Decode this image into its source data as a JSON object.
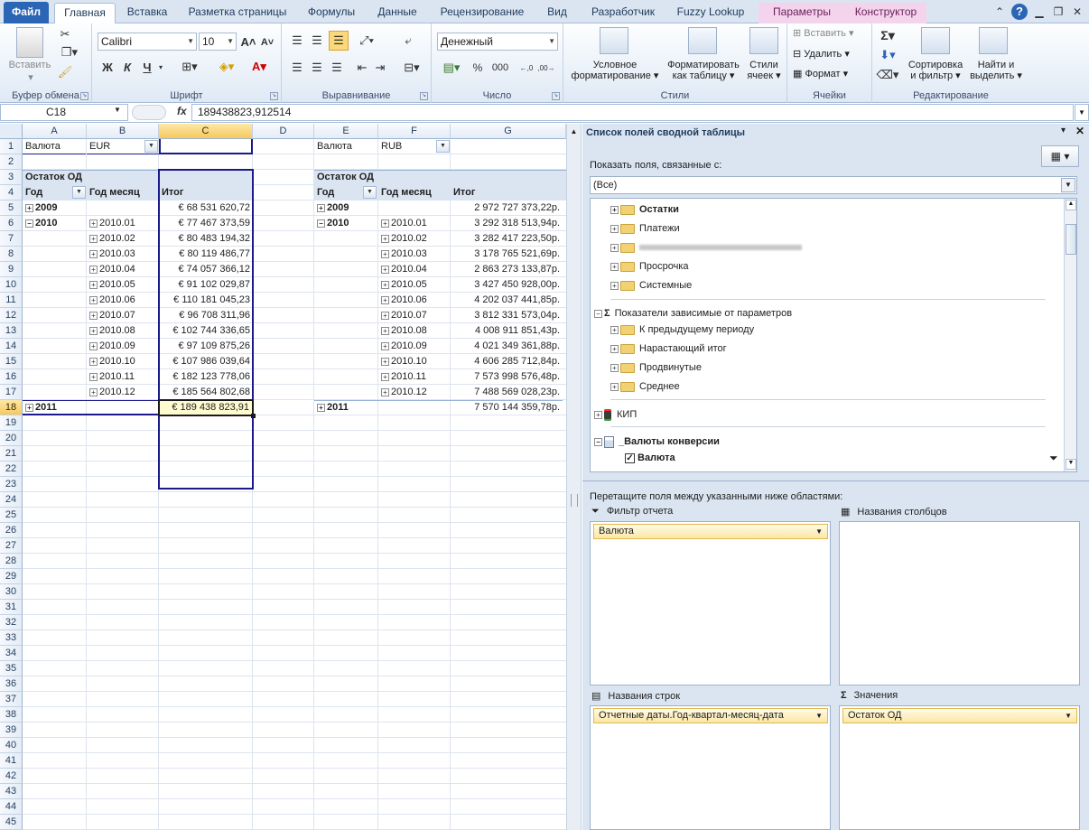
{
  "tabs": {
    "file": "Файл",
    "items": [
      "Главная",
      "Вставка",
      "Разметка страницы",
      "Формулы",
      "Данные",
      "Рецензирование",
      "Вид",
      "Разработчик",
      "Fuzzy Lookup"
    ],
    "context": [
      "Параметры",
      "Конструктор"
    ]
  },
  "ribbon": {
    "clipboard": {
      "paste": "Вставить",
      "label": "Буфер обмена"
    },
    "font": {
      "name": "Calibri",
      "size": "10",
      "label": "Шрифт",
      "bold": "Ж",
      "italic": "К",
      "underline": "Ч"
    },
    "alignment": {
      "label": "Выравнивание"
    },
    "number": {
      "format": "Денежный",
      "percent": "%",
      "thousands": "000",
      "label": "Число"
    },
    "styles": {
      "conditional": "Условное",
      "conditional2": "форматирование",
      "format_table": "Форматировать",
      "format_table2": "как таблицу",
      "cell_styles": "Стили",
      "cell_styles2": "ячеек",
      "label": "Стили"
    },
    "cells": {
      "insert": "Вставить",
      "delete": "Удалить",
      "format": "Формат",
      "label": "Ячейки"
    },
    "editing": {
      "sigma": "Σ",
      "sort": "Сортировка",
      "sort2": "и фильтр",
      "find": "Найти и",
      "find2": "выделить",
      "label": "Редактирование"
    }
  },
  "formula_bar": {
    "name_box": "C18",
    "fx": "fx",
    "value": "189438823,912514"
  },
  "sheet": {
    "columns": [
      "A",
      "B",
      "C",
      "D",
      "E",
      "F",
      "G"
    ],
    "rows": [
      "1",
      "2",
      "3",
      "4",
      "5",
      "6",
      "7",
      "8",
      "9",
      "10",
      "11",
      "12",
      "13",
      "14",
      "15",
      "16",
      "17",
      "18",
      "19",
      "20",
      "21",
      "22",
      "23",
      "24",
      "25",
      "26",
      "27",
      "28",
      "29",
      "30",
      "31",
      "32",
      "33",
      "34",
      "35",
      "36",
      "37",
      "38",
      "39",
      "40",
      "41",
      "42",
      "43",
      "44",
      "45"
    ],
    "left_pivot": {
      "filter_label": "Валюта",
      "filter_value": "EUR",
      "measure": "Остаток ОД",
      "col_year": "Год",
      "col_month": "Год месяц",
      "col_total": "Итог",
      "rows": [
        {
          "year": "2009",
          "month": "",
          "value": "€ 68 531 620,72"
        },
        {
          "year": "2010",
          "month": "2010.01",
          "value": "€ 77 467 373,59"
        },
        {
          "year": "",
          "month": "2010.02",
          "value": "€ 80 483 194,32"
        },
        {
          "year": "",
          "month": "2010.03",
          "value": "€ 80 119 486,77"
        },
        {
          "year": "",
          "month": "2010.04",
          "value": "€ 74 057 366,12"
        },
        {
          "year": "",
          "month": "2010.05",
          "value": "€ 91 102 029,87"
        },
        {
          "year": "",
          "month": "2010.06",
          "value": "€ 110 181 045,23"
        },
        {
          "year": "",
          "month": "2010.07",
          "value": "€ 96 708 311,96"
        },
        {
          "year": "",
          "month": "2010.08",
          "value": "€ 102 744 336,65"
        },
        {
          "year": "",
          "month": "2010.09",
          "value": "€ 97 109 875,26"
        },
        {
          "year": "",
          "month": "2010.10",
          "value": "€ 107 986 039,64"
        },
        {
          "year": "",
          "month": "2010.11",
          "value": "€ 182 123 778,06"
        },
        {
          "year": "",
          "month": "2010.12",
          "value": "€ 185 564 802,68"
        },
        {
          "year": "2011",
          "month": "",
          "value": "€ 189 438 823,91"
        }
      ]
    },
    "right_pivot": {
      "filter_label": "Валюта",
      "filter_value": "RUB",
      "measure": "Остаток ОД",
      "col_year": "Год",
      "col_month": "Год месяц",
      "col_total": "Итог",
      "rows": [
        {
          "year": "2009",
          "month": "",
          "value": "2 972 727 373,22р."
        },
        {
          "year": "2010",
          "month": "2010.01",
          "value": "3 292 318 513,94р."
        },
        {
          "year": "",
          "month": "2010.02",
          "value": "3 282 417 223,50р."
        },
        {
          "year": "",
          "month": "2010.03",
          "value": "3 178 765 521,69р."
        },
        {
          "year": "",
          "month": "2010.04",
          "value": "2 863 273 133,87р."
        },
        {
          "year": "",
          "month": "2010.05",
          "value": "3 427 450 928,00р."
        },
        {
          "year": "",
          "month": "2010.06",
          "value": "4 202 037 441,85р."
        },
        {
          "year": "",
          "month": "2010.07",
          "value": "3 812 331 573,04р."
        },
        {
          "year": "",
          "month": "2010.08",
          "value": "4 008 911 851,43р."
        },
        {
          "year": "",
          "month": "2010.09",
          "value": "4 021 349 361,88р."
        },
        {
          "year": "",
          "month": "2010.10",
          "value": "4 606 285 712,84р."
        },
        {
          "year": "",
          "month": "2010.11",
          "value": "7 573 998 576,48р."
        },
        {
          "year": "",
          "month": "2010.12",
          "value": "7 488 569 028,23р."
        },
        {
          "year": "2011",
          "month": "",
          "value": "7 570 144 359,78р."
        }
      ]
    }
  },
  "pane": {
    "title": "Список полей сводной таблицы",
    "show_related": "Показать поля, связанные с:",
    "related_value": "(Все)",
    "fields": [
      "Остатки",
      "Платежи",
      "Просрочка",
      "Системные"
    ],
    "group_title": "Показатели зависимые от параметров",
    "group_items": [
      "К предыдущему периоду",
      "Нарастающий итог",
      "Продвинутые",
      "Среднее"
    ],
    "kip": "КИП",
    "conv": "_Валюты конверсии",
    "conv_field": "Валюта",
    "drag_hint": "Перетащите поля между указанными ниже областями:",
    "zone_filter": "Фильтр отчета",
    "zone_cols": "Названия столбцов",
    "zone_rows": "Названия строк",
    "zone_values": "Значения",
    "filter_chip": "Валюта",
    "rows_chip": "Отчетные даты.Год-квартал-месяц-дата",
    "values_chip": "Остаток ОД"
  }
}
